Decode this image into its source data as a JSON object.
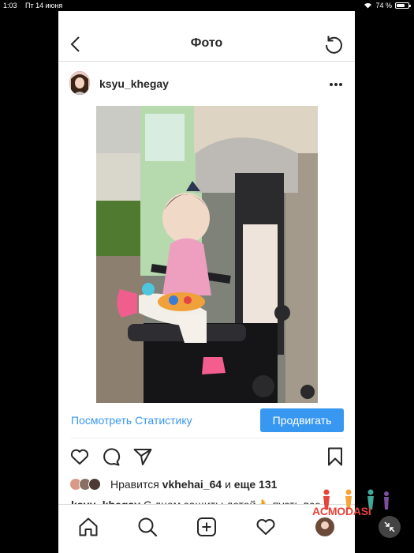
{
  "status_bar": {
    "time": "1:03",
    "date": "Пт 14 июня",
    "battery_text": "74 %",
    "battery_level": 0.74
  },
  "nav": {
    "title": "Фото"
  },
  "post": {
    "username": "ksyu_khegay",
    "insights_link": "Посмотреть Статистику",
    "promote_button": "Продвигать",
    "likes_prefix": "Нравится",
    "likes_user": "vkhehai_64",
    "likes_and": "и",
    "likes_others": "еще 131",
    "caption_user": "ksyu_khegay",
    "caption_text": "С днем защиты детей👌 пусть все"
  },
  "watermark": {
    "text": "ACMODASI"
  },
  "icons": [
    "back-icon",
    "refresh-icon",
    "more-icon",
    "heart-icon",
    "comment-icon",
    "share-icon",
    "bookmark-icon",
    "home-icon",
    "search-icon",
    "add-post-icon",
    "activity-icon",
    "profile-icon"
  ],
  "colors": {
    "accent": "#3897f0",
    "text": "#262626",
    "divider": "#dbdbdb",
    "watermark": "#e8433b"
  }
}
